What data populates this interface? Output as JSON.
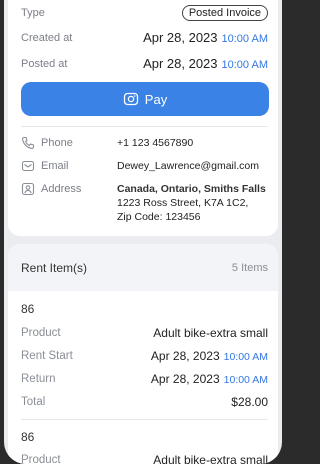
{
  "order": {
    "type_label": "Type",
    "type_badge": "Posted Invoice",
    "created_label": "Created at",
    "created_date": "Apr 28, 2023",
    "created_time": "10:00 AM",
    "posted_label": "Posted at",
    "posted_date": "Apr 28, 2023",
    "posted_time": "10:00 AM",
    "pay_label": "Pay"
  },
  "contact": {
    "phone_label": "Phone",
    "phone_value": "+1 123 4567890",
    "email_label": "Email",
    "email_value": "Dewey_Lawrence@gmail.com",
    "address_label": "Address",
    "address_line1": "Canada, Ontario, Smiths Falls",
    "address_line2": "1223 Ross Street, K7A 1C2,",
    "address_line3": "Zip Code: 123456"
  },
  "rent_items": {
    "title": "Rent Item(s)",
    "count": "5 Items",
    "items": [
      {
        "id": "86",
        "product_label": "Product",
        "product_value": "Adult bike-extra small",
        "start_label": "Rent Start",
        "start_date": "Apr 28, 2023",
        "start_time": "10:00 AM",
        "return_label": "Return",
        "return_date": "Apr 28, 2023",
        "return_time": "10:00 AM",
        "total_label": "Total",
        "total_value": "$28.00"
      },
      {
        "id": "86",
        "product_label": "Product",
        "product_value": "Adult bike-extra small"
      }
    ]
  },
  "colors": {
    "accent": "#3a82e6",
    "time_blue": "#3478e0",
    "background": "#ebecf0"
  },
  "icons": [
    "phone-icon",
    "email-icon",
    "address-icon",
    "pay-icon"
  ]
}
